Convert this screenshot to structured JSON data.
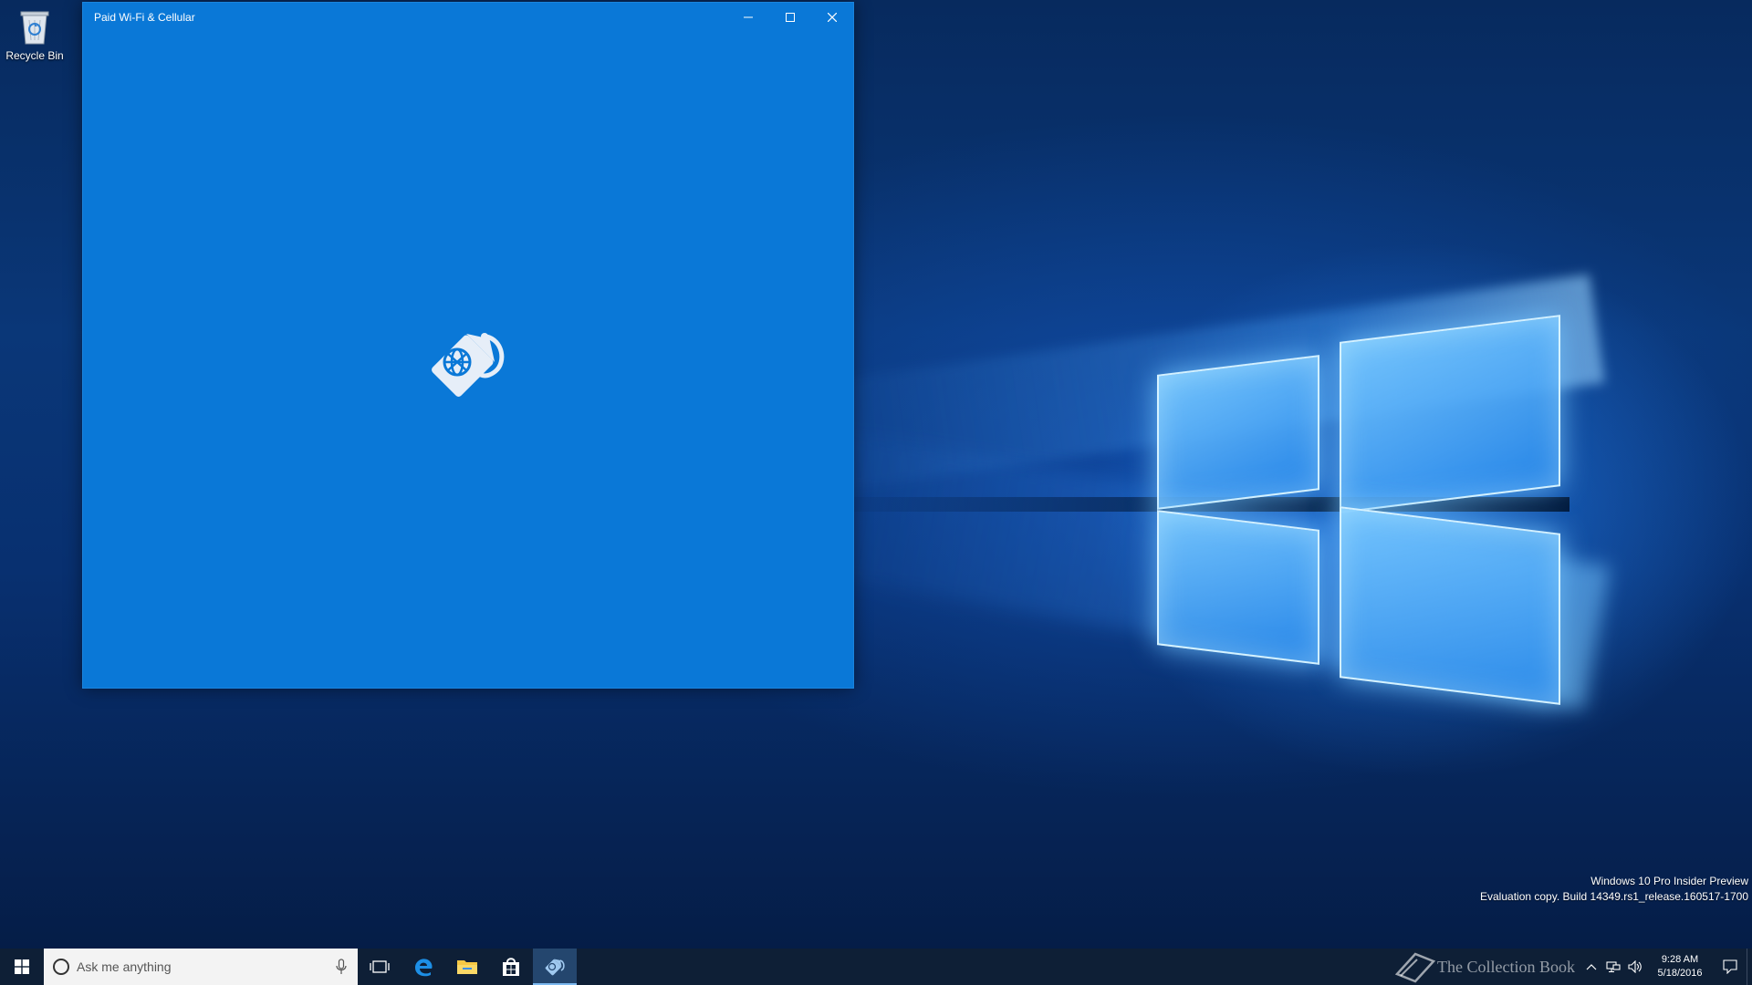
{
  "desktop": {
    "icons": [
      {
        "label": "Recycle Bin",
        "icon": "recycle-bin-icon"
      }
    ]
  },
  "window": {
    "title": "Paid Wi-Fi & Cellular",
    "splash_icon": "paid-wifi-cellular-tag-icon",
    "background_color": "#0a78d7",
    "controls": [
      "minimize-icon",
      "maximize-icon",
      "close-icon"
    ]
  },
  "watermark": {
    "line1": "Windows 10 Pro Insider Preview",
    "line2": "Evaluation copy. Build 14349.rs1_release.160517-1700"
  },
  "taskbar": {
    "search_placeholder": "Ask me anything",
    "pinned": [
      {
        "name": "Task View",
        "icon": "task-view-icon"
      },
      {
        "name": "Microsoft Edge",
        "icon": "edge-icon"
      },
      {
        "name": "File Explorer",
        "icon": "folder-icon"
      },
      {
        "name": "Store",
        "icon": "store-icon"
      },
      {
        "name": "Paid Wi-Fi & Cellular",
        "icon": "paid-wifi-cellular-icon",
        "active": true
      }
    ],
    "tray": {
      "brand_text": "The Collection Book",
      "time": "9:28 AM",
      "date": "5/18/2016",
      "icons": [
        "chevron-up-icon",
        "network-icon",
        "volume-icon",
        "notifications-icon"
      ]
    },
    "accent_color": "#0e1f36"
  }
}
